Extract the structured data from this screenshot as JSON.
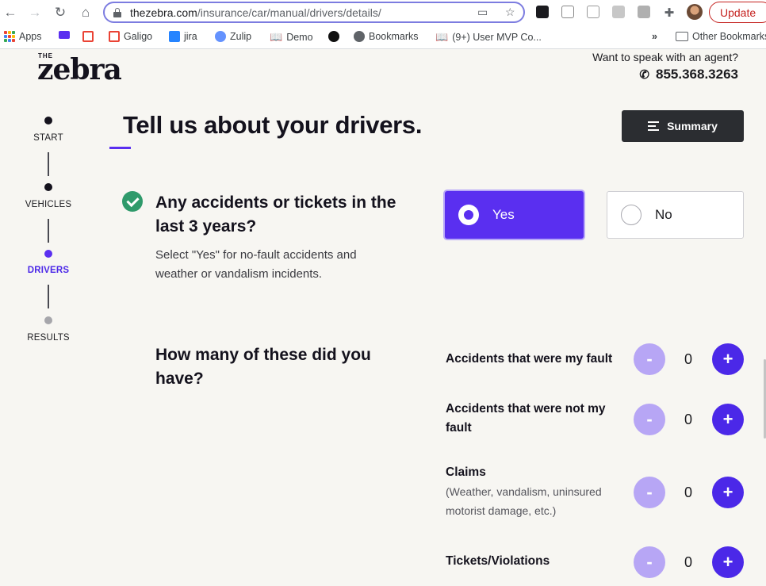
{
  "browser": {
    "url_host": "thezebra.com",
    "url_path": "/insurance/car/manual/drivers/details/",
    "update_label": "Update"
  },
  "bookmarks": {
    "items": [
      {
        "label": "Apps",
        "icon": "apps-grid-icon"
      },
      {
        "label": "",
        "icon": "mail-icon"
      },
      {
        "label": "",
        "icon": "gmail-icon"
      },
      {
        "label": "Galigo",
        "icon": "gmail-icon"
      },
      {
        "label": "jira",
        "icon": "jira-icon"
      },
      {
        "label": "Zulip",
        "icon": "zulip-icon"
      },
      {
        "label": "Demo",
        "icon": "book-icon"
      },
      {
        "label": "",
        "icon": "jd-icon"
      },
      {
        "label": "Bookmarks",
        "icon": "globe-icon"
      },
      {
        "label": "(9+) User MVP Co...",
        "icon": "book-icon"
      }
    ],
    "overflow": "»",
    "other": "Other Bookmarks"
  },
  "header": {
    "logo_the": "THE",
    "logo": "zebra",
    "agent_prompt": "Want to speak with an agent?",
    "agent_phone": "855.368.3263"
  },
  "stepper": {
    "steps": [
      {
        "label": "START",
        "state": "done"
      },
      {
        "label": "VEHICLES",
        "state": "done"
      },
      {
        "label": "DRIVERS",
        "state": "active"
      },
      {
        "label": "RESULTS",
        "state": "upcoming"
      }
    ]
  },
  "main": {
    "title": "Tell us about your drivers.",
    "summary_label": "Summary",
    "question1": "Any accidents or tickets in the last 3 years?",
    "question1_help": "Select \"Yes\" for no-fault accidents and weather or vandalism incidents.",
    "yes_label": "Yes",
    "no_label": "No",
    "selected": "Yes",
    "question2": "How many of these did you have?",
    "counters": [
      {
        "label": "Accidents that were my fault",
        "sub": "",
        "value": 0
      },
      {
        "label": "Accidents that were not my fault",
        "sub": "",
        "value": 0
      },
      {
        "label": "Claims",
        "sub": "(Weather, vandalism, uninsured motorist damage, etc.)",
        "value": 0
      },
      {
        "label": "Tickets/Violations",
        "sub": "",
        "value": 0
      }
    ],
    "minus_symbol": "-",
    "plus_symbol": "+"
  },
  "colors": {
    "accent": "#5a2ff0",
    "accent_light": "#b7a6f5",
    "success": "#2f9a6b",
    "dark_button": "#2b2d31",
    "background": "#f7f6f2"
  }
}
